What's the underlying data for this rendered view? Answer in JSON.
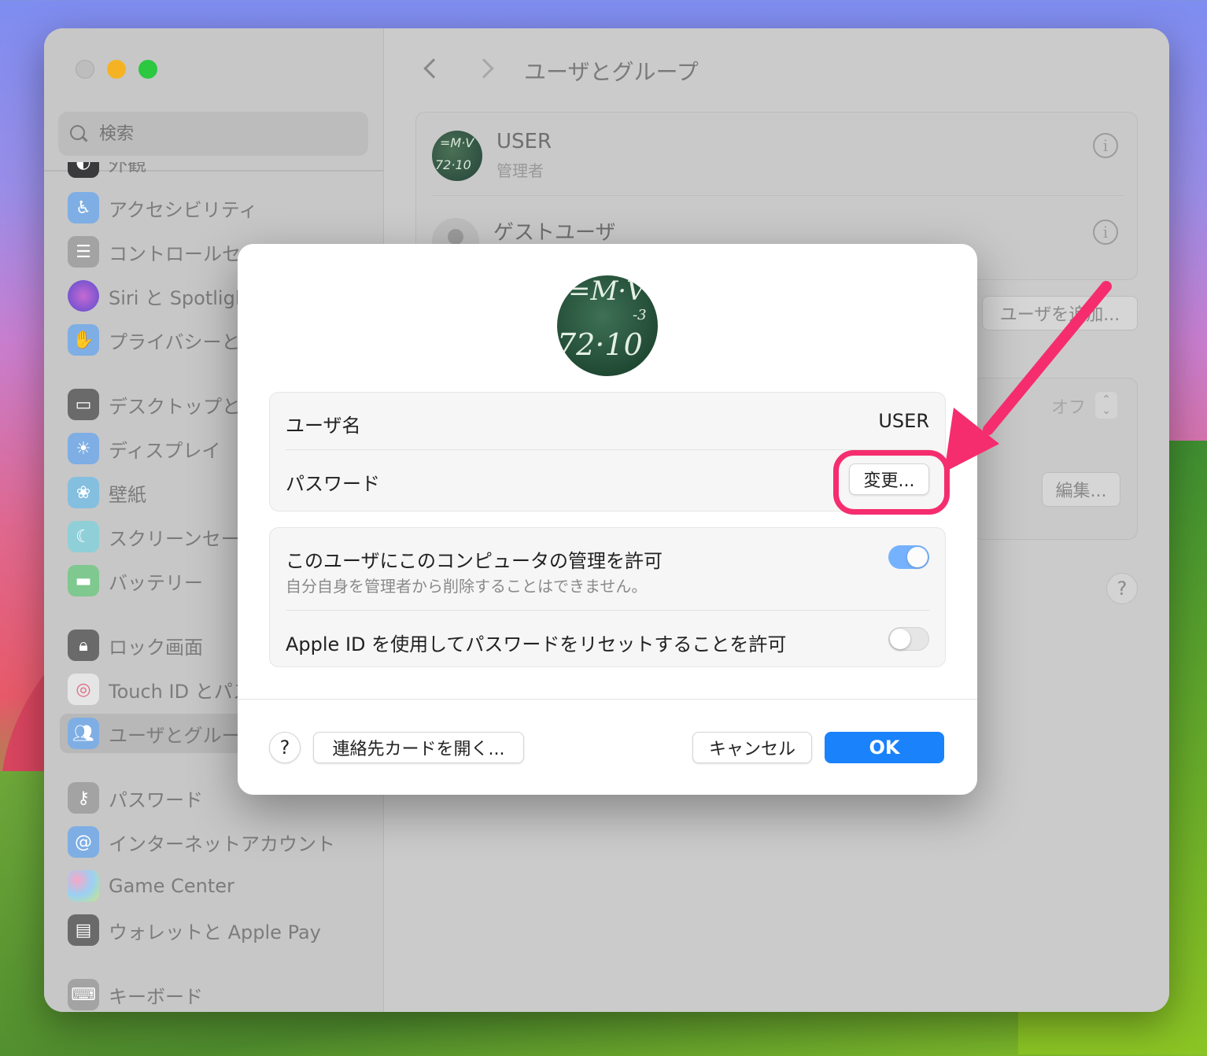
{
  "window": {
    "title": "ユーザとグループ",
    "search_placeholder": "検索"
  },
  "sidebar": {
    "partial_top_label": "外観",
    "items": [
      {
        "label": "アクセシビリティ",
        "icon": "accessibility-icon",
        "color": "#2f8cf2"
      },
      {
        "label": "コントロールセンター",
        "icon": "control-center-icon",
        "color": "#8e8e93"
      },
      {
        "label": "Siri と Spotlight",
        "icon": "siri-icon",
        "color": "#7d3cd2"
      },
      {
        "label": "プライバシーとセキュリティ",
        "icon": "hand-icon",
        "color": "#2f8cf2"
      },
      {
        "label": "デスクトップとDock",
        "icon": "desktop-icon",
        "color": "#3a3a3c"
      },
      {
        "label": "ディスプレイ",
        "icon": "sun-icon",
        "color": "#2f8cf2"
      },
      {
        "label": "壁紙",
        "icon": "flower-icon",
        "color": "#34aadc"
      },
      {
        "label": "スクリーンセーバ",
        "icon": "screensaver-icon",
        "color": "#5ac8d8"
      },
      {
        "label": "バッテリー",
        "icon": "battery-icon",
        "color": "#34c759"
      },
      {
        "label": "ロック画面",
        "icon": "lock-icon",
        "color": "#3a3a3c"
      },
      {
        "label": "Touch ID とパスワード",
        "icon": "fingerprint-icon",
        "color": "#ff2d55"
      },
      {
        "label": "ユーザとグループ",
        "icon": "users-icon",
        "color": "#2f8cf2"
      },
      {
        "label": "パスワード",
        "icon": "key-icon",
        "color": "#8e8e93"
      },
      {
        "label": "インターネットアカウント",
        "icon": "at-icon",
        "color": "#2f8cf2"
      },
      {
        "label": "Game Center",
        "icon": "game-center-icon",
        "color": "#ff9f0a"
      },
      {
        "label": "ウォレットと Apple Pay",
        "icon": "wallet-icon",
        "color": "#3a3a3c"
      },
      {
        "label": "キーボード",
        "icon": "keyboard-icon",
        "color": "#8e8e93"
      }
    ]
  },
  "main": {
    "users": [
      {
        "name": "USER",
        "role": "管理者"
      },
      {
        "name": "ゲストユーザ",
        "role": ""
      }
    ],
    "add_user_button": "ユーザを追加...",
    "auto_login_value": "オフ",
    "edit_button": "編集...",
    "help": "?"
  },
  "dialog": {
    "avatar_chalk": [
      "=M·V",
      "-3",
      "72·10"
    ],
    "username_label": "ユーザ名",
    "username_value": "USER",
    "password_label": "パスワード",
    "change_button": "変更...",
    "admin_label": "このユーザにこのコンピュータの管理を許可",
    "admin_sub": "自分自身を管理者から削除することはできません。",
    "admin_toggle_on": true,
    "appleid_label": "Apple ID を使用してパスワードをリセットすることを許可",
    "appleid_toggle_on": false,
    "help": "?",
    "contact_button": "連絡先カードを開く...",
    "cancel_button": "キャンセル",
    "ok_button": "OK"
  },
  "annotation_color": "#f52d6f"
}
